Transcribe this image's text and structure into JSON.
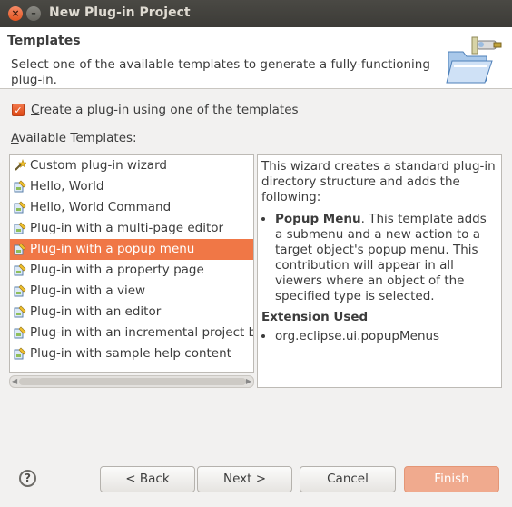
{
  "window": {
    "title": "New Plug-in Project",
    "close_glyph": "×",
    "minimize_glyph": "–"
  },
  "header": {
    "title": "Templates",
    "description": "Select one of the available templates to generate a fully-functioning plug-in.",
    "icon": "plugin-folder-wizard-icon"
  },
  "use_template": {
    "checked": true,
    "check_glyph": "✓",
    "label_underlined": "C",
    "label_rest": "reate a plug-in using one of the templates"
  },
  "templates": {
    "label_underlined": "A",
    "label_rest": "vailable Templates:",
    "items": [
      {
        "label": "Custom plug-in wizard",
        "icon": "custom-wizard-icon"
      },
      {
        "label": "Hello, World",
        "icon": "plugin-template-icon"
      },
      {
        "label": "Hello, World Command",
        "icon": "plugin-template-icon"
      },
      {
        "label": "Plug-in with a multi-page editor",
        "icon": "plugin-template-icon"
      },
      {
        "label": "Plug-in with a popup menu",
        "icon": "plugin-template-icon",
        "selected": true
      },
      {
        "label": "Plug-in with a property page",
        "icon": "plugin-template-icon"
      },
      {
        "label": "Plug-in with a view",
        "icon": "plugin-template-icon"
      },
      {
        "label": "Plug-in with an editor",
        "icon": "plugin-template-icon"
      },
      {
        "label": "Plug-in with an incremental project bu",
        "icon": "plugin-template-icon"
      },
      {
        "label": "Plug-in with sample help content",
        "icon": "plugin-template-icon"
      }
    ]
  },
  "description_panel": {
    "intro": "This wizard creates a standard plug-in directory structure and adds the following:",
    "bullet_bold": "Popup Menu",
    "bullet_text": ". This template adds a submenu and a new action to a target object's popup menu. This contribution will appear in all viewers where an object of the specified type is selected.",
    "extension_heading": "Extension Used",
    "extension": "org.eclipse.ui.popupMenus"
  },
  "buttons": {
    "help": "?",
    "back": "< Back",
    "next": "Next >",
    "cancel": "Cancel",
    "finish": "Finish"
  },
  "colors": {
    "accent": "#f07746",
    "finish_bg": "#f0aa8e"
  }
}
